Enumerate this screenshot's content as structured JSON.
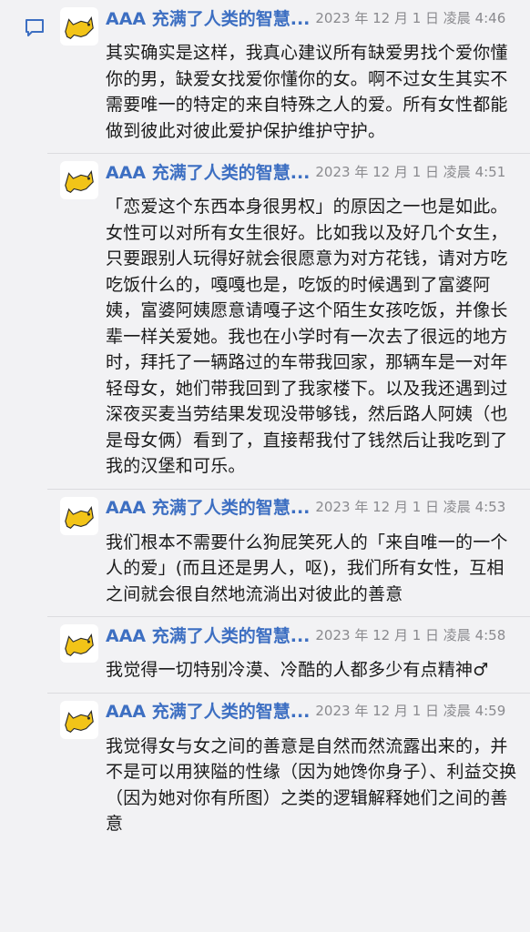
{
  "comments": [
    {
      "name": "AAA 充满了人类的智慧...",
      "time": "2023 年 12 月 1 日 凌晨 4:46",
      "text": "其实确实是这样，我真心建议所有缺爱男找个爱你懂你的男，缺爱女找爱你懂你的女。啊不过女生其实不需要唯一的特定的来自特殊之人的爱。所有女性都能做到彼此对彼此爱护保护维护守护。"
    },
    {
      "name": "AAA 充满了人类的智慧...",
      "time": "2023 年 12 月 1 日 凌晨 4:51",
      "text": "「恋爱这个东西本身很男权」的原因之一也是如此。女性可以对所有女生很好。比如我以及好几个女生，只要跟别人玩得好就会很愿意为对方花钱，请对方吃吃饭什么的，嘎嘎也是，吃饭的时候遇到了富婆阿姨，富婆阿姨愿意请嘎子这个陌生女孩吃饭，并像长辈一样关爱她。我也在小学时有一次去了很远的地方时，拜托了一辆路过的车带我回家，那辆车是一对年轻母女，她们带我回到了我家楼下。以及我还遇到过深夜买麦当劳结果发现没带够钱，然后路人阿姨（也是母女俩）看到了，直接帮我付了钱然后让我吃到了我的汉堡和可乐。"
    },
    {
      "name": "AAA 充满了人类的智慧...",
      "time": "2023 年 12 月 1 日 凌晨 4:53",
      "text": "我们根本不需要什么狗屁笑死人的「来自唯一的一个人的爱」(而且还是男人，呕)，我们所有女性，互相之间就会很自然地流淌出对彼此的善意"
    },
    {
      "name": "AAA 充满了人类的智慧...",
      "time": "2023 年 12 月 1 日 凌晨 4:58",
      "text": "我觉得一切特别冷漠、冷酷的人都多少有点精神♂"
    },
    {
      "name": "AAA 充满了人类的智慧...",
      "time": "2023 年 12 月 1 日 凌晨 4:59",
      "text": "我觉得女与女之间的善意是自然而然流露出来的，并不是可以用狭隘的性缘（因为她馋你身子）、利益交换（因为她对你有所图）之类的逻辑解释她们之间的善意"
    }
  ],
  "colors": {
    "name": "#3d6fc2",
    "time": "#8a8a8e",
    "icon": "#3d6fc2",
    "avatar_cat": "#f2c418"
  },
  "icons": {
    "left": "comment-bubble-icon",
    "avatar": "cat-avatar-icon"
  }
}
